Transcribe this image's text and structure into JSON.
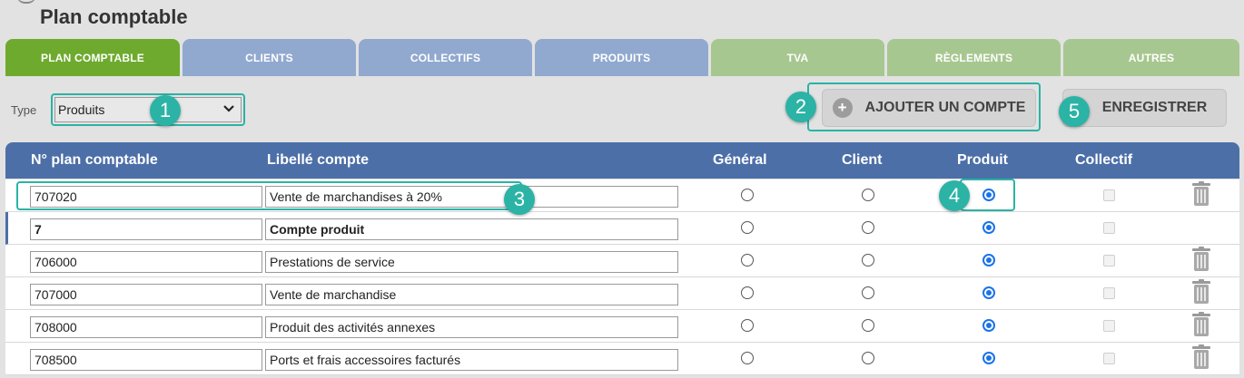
{
  "page": {
    "title": "Plan comptable"
  },
  "tabs": [
    {
      "label": "PLAN COMPTABLE",
      "state": "active"
    },
    {
      "label": "CLIENTS",
      "state": "blue"
    },
    {
      "label": "COLLECTIFS",
      "state": "blue"
    },
    {
      "label": "PRODUITS",
      "state": "blue"
    },
    {
      "label": "TVA",
      "state": "green"
    },
    {
      "label": "RÈGLEMENTS",
      "state": "green"
    },
    {
      "label": "AUTRES",
      "state": "green"
    }
  ],
  "filter": {
    "label": "Type",
    "selected": "Produits"
  },
  "toolbar": {
    "add_label": "AJOUTER UN COMPTE",
    "add_icon": "plus-icon",
    "save_label": "ENREGISTRER"
  },
  "badges": [
    "1",
    "2",
    "3",
    "4",
    "5"
  ],
  "table": {
    "headers": [
      "N° plan comptable",
      "Libellé compte",
      "Général",
      "Client",
      "Produit",
      "Collectif"
    ],
    "rows": [
      {
        "number": "707020",
        "label": "Vente de marchandises à 20%",
        "type": "produit",
        "collectif": false,
        "deletable": true,
        "bold": false
      },
      {
        "number": "7",
        "label": "Compte produit",
        "type": "produit",
        "collectif": false,
        "deletable": false,
        "bold": true
      },
      {
        "number": "706000",
        "label": "Prestations de service",
        "type": "produit",
        "collectif": false,
        "deletable": true,
        "bold": false
      },
      {
        "number": "707000",
        "label": "Vente de marchandise",
        "type": "produit",
        "collectif": false,
        "deletable": true,
        "bold": false
      },
      {
        "number": "708000",
        "label": "Produit des activités annexes",
        "type": "produit",
        "collectif": false,
        "deletable": true,
        "bold": false
      },
      {
        "number": "708500",
        "label": "Ports et frais accessoires facturés",
        "type": "produit",
        "collectif": false,
        "deletable": true,
        "bold": false
      }
    ]
  },
  "colors": {
    "accent_teal": "#2bb3a5",
    "tab_active": "#6eaa2e",
    "tab_blue": "#91a9cf",
    "tab_green": "#a7c790",
    "header_blue": "#4c6fa8",
    "radio_checked": "#1a73e8"
  }
}
